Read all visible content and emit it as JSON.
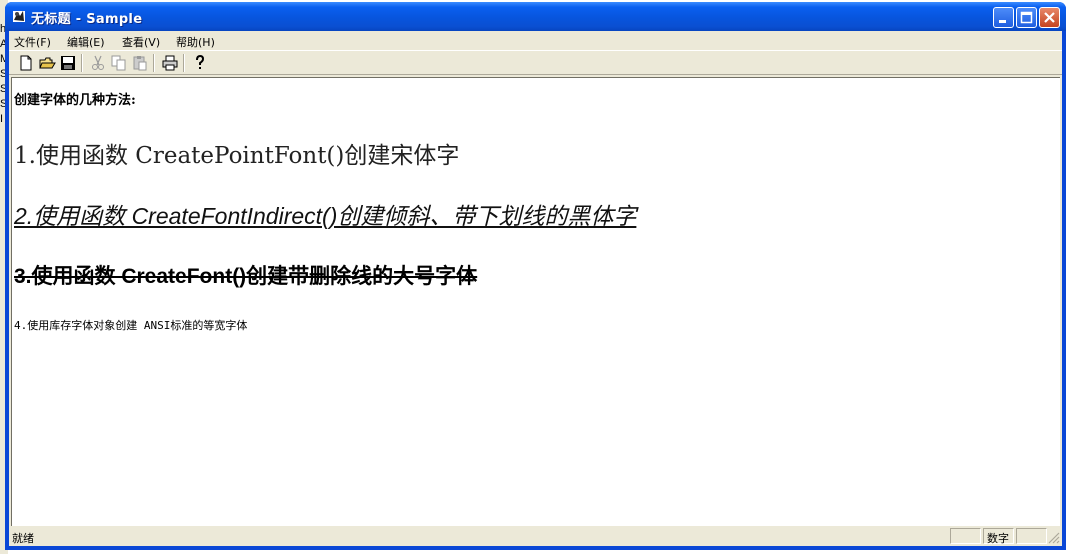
{
  "background_window": {
    "edge_letters": [
      "h",
      "A",
      "M",
      "S",
      "S",
      "S",
      "I"
    ]
  },
  "window": {
    "title": "无标题 - Sample",
    "controls": {
      "minimize": "minimize",
      "maximize": "maximize",
      "close": "close"
    }
  },
  "menu": {
    "items": [
      {
        "label": "文件(F)"
      },
      {
        "label": "编辑(E)"
      },
      {
        "label": "查看(V)"
      },
      {
        "label": "帮助(H)"
      }
    ]
  },
  "toolbar": {
    "icons": [
      "new-file-icon",
      "open-folder-icon",
      "save-icon",
      "cut-icon",
      "copy-icon",
      "paste-icon",
      "print-icon",
      "help-icon"
    ]
  },
  "document": {
    "heading": "创建字体的几种方法:",
    "line1": "1.使用函数 CreatePointFont()创建宋体字",
    "line2": "2.使用函数 CreateFontIndirect()创建倾斜、带下划线的黑体字",
    "line3": "3.使用函数 CreateFont()创建带删除线的大号字体",
    "line4": "4.使用库存字体对象创建 ANSI标准的等宽字体"
  },
  "status": {
    "text": "就绪",
    "num_indicator": "数字"
  },
  "colors": {
    "titlebar": "#0a5ff0",
    "chrome": "#ece9d8",
    "close_button": "#c4431f"
  }
}
